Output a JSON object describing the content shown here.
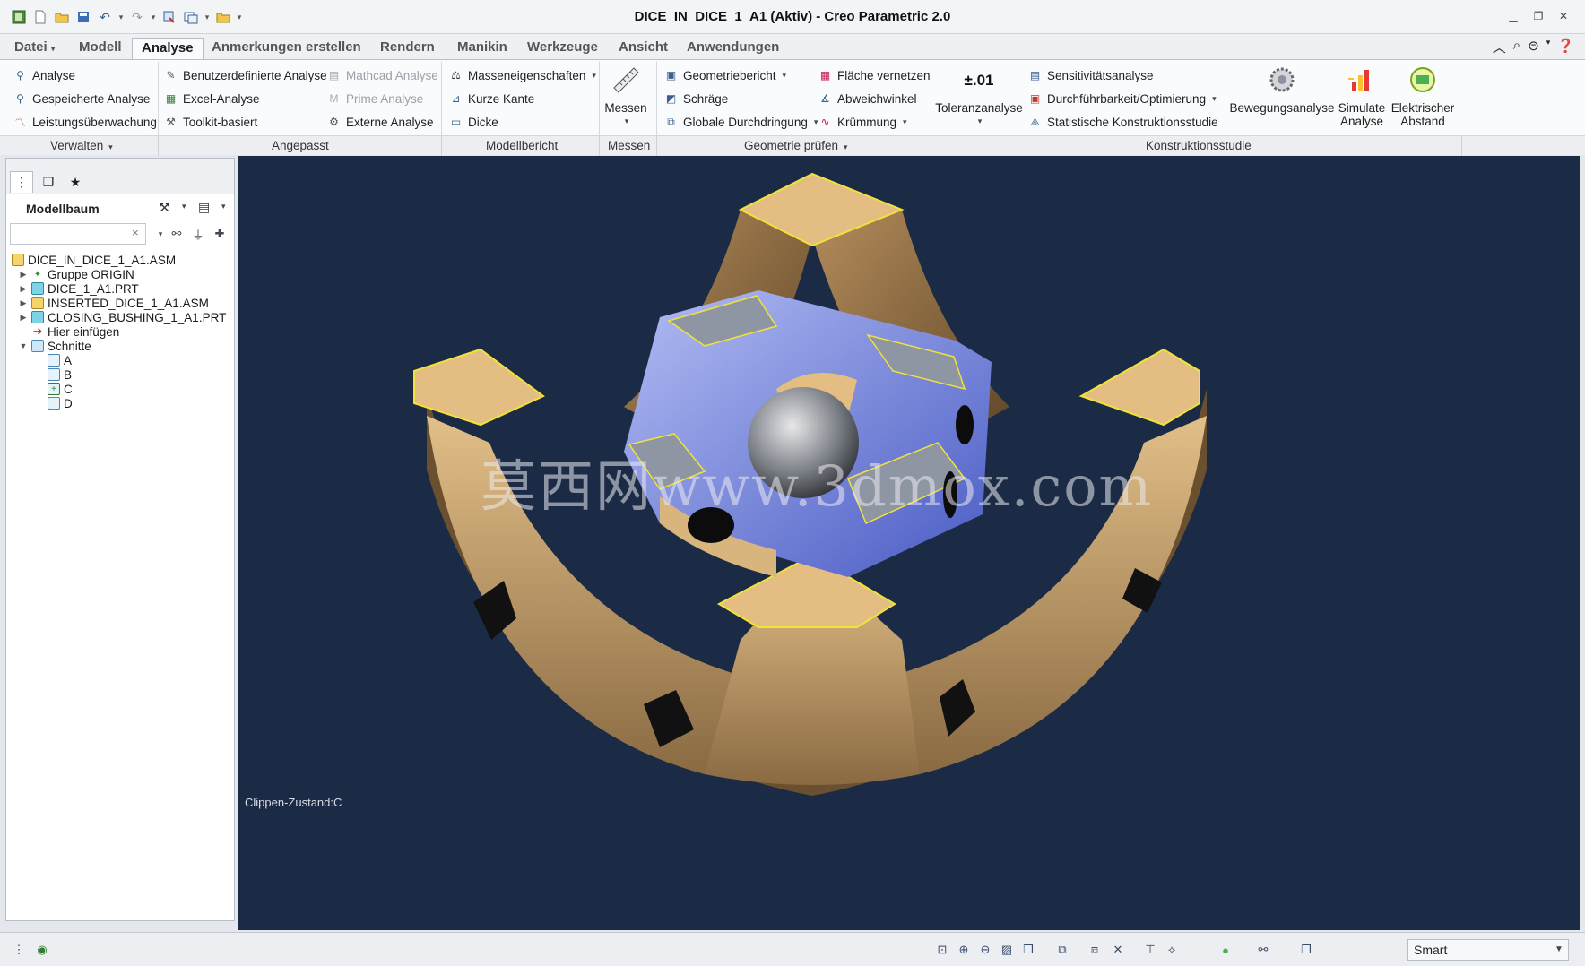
{
  "window": {
    "title": "DICE_IN_DICE_1_A1 (Aktiv) - Creo Parametric 2.0",
    "controls": [
      "minimize-icon",
      "restore-icon",
      "close-icon"
    ]
  },
  "quick_access": [
    "app-icon",
    "new-icon",
    "open-icon",
    "save-icon",
    "undo-icon",
    "redo-icon",
    "regenerate-icon",
    "windows-icon",
    "close-window-icon",
    "customize-icon"
  ],
  "tabs": [
    "Datei",
    "Modell",
    "Analyse",
    "Anmerkungen erstellen",
    "Rendern",
    "Manikin",
    "Werkzeuge",
    "Ansicht",
    "Anwendungen"
  ],
  "active_tab": "Analyse",
  "ribbon": {
    "verwalten": [
      "Analyse",
      "Gespeicherte Analyse",
      "Leistungsüberwachung"
    ],
    "angepasst": {
      "col1": [
        "Benutzerdefinierte Analyse",
        "Excel-Analyse",
        "Toolkit-basiert"
      ],
      "col2": [
        "Mathcad Analyse",
        "Prime Analyse",
        "Externe Analyse"
      ]
    },
    "modellbericht": [
      "Masseneigenschaften",
      "Kurze Kante",
      "Dicke"
    ],
    "messen": "Messen",
    "geometrie": {
      "col1": [
        "Geometriebericht",
        "Schräge",
        "Globale Durchdringung"
      ],
      "col2": [
        "Fläche vernetzen",
        "Abweichwinkel",
        "Krümmung"
      ]
    },
    "toleranz": "Toleranzanalyse",
    "toleranz_glyph": "±.01",
    "konstruktion": [
      "Sensitivitätsanalyse",
      "Durchführbarkeit/Optimierung",
      "Statistische Konstruktionsstudie"
    ],
    "bewegung": "Bewegungsanalyse",
    "simulate": [
      "Simulate",
      "Analyse"
    ],
    "elektrisch": [
      "Elektrischer",
      "Abstand"
    ],
    "groups": [
      "Verwalten",
      "Angepasst",
      "Modellbericht",
      "Messen",
      "Geometrie prüfen",
      "Konstruktionsstudie"
    ]
  },
  "model_tree": {
    "title": "Modellbaum",
    "search_placeholder": "",
    "clear_glyph": "×",
    "nodes": [
      {
        "label": "DICE_IN_DICE_1_A1.ASM",
        "icon": "assembly-icon"
      },
      {
        "label": "Gruppe ORIGIN",
        "icon": "group-icon"
      },
      {
        "label": "DICE_1_A1.PRT",
        "icon": "part-icon"
      },
      {
        "label": "INSERTED_DICE_1_A1.ASM",
        "icon": "assembly-icon"
      },
      {
        "label": "CLOSING_BUSHING_1_A1.PRT",
        "icon": "part-icon"
      },
      {
        "label": "Hier einfügen",
        "icon": "insert-arrow-icon"
      },
      {
        "label": "Schnitte",
        "icon": "sections-icon"
      },
      {
        "label": "A",
        "icon": "section-icon"
      },
      {
        "label": "B",
        "icon": "section-icon"
      },
      {
        "label": "C",
        "icon": "section-active-icon"
      },
      {
        "label": "D",
        "icon": "section-icon"
      }
    ]
  },
  "viewport": {
    "clip_state": "Clippen-Zustand:C",
    "watermark": "莫西网www.3dmox.com",
    "background": "#1b2b45",
    "colors": {
      "outer_part": "#c9a574",
      "inner_blue": "#7f8fe0",
      "frame_gray": "#8e96a4",
      "edge_highlight": "#f1e23a"
    }
  },
  "statusbar": {
    "selection_filter": "Smart"
  }
}
